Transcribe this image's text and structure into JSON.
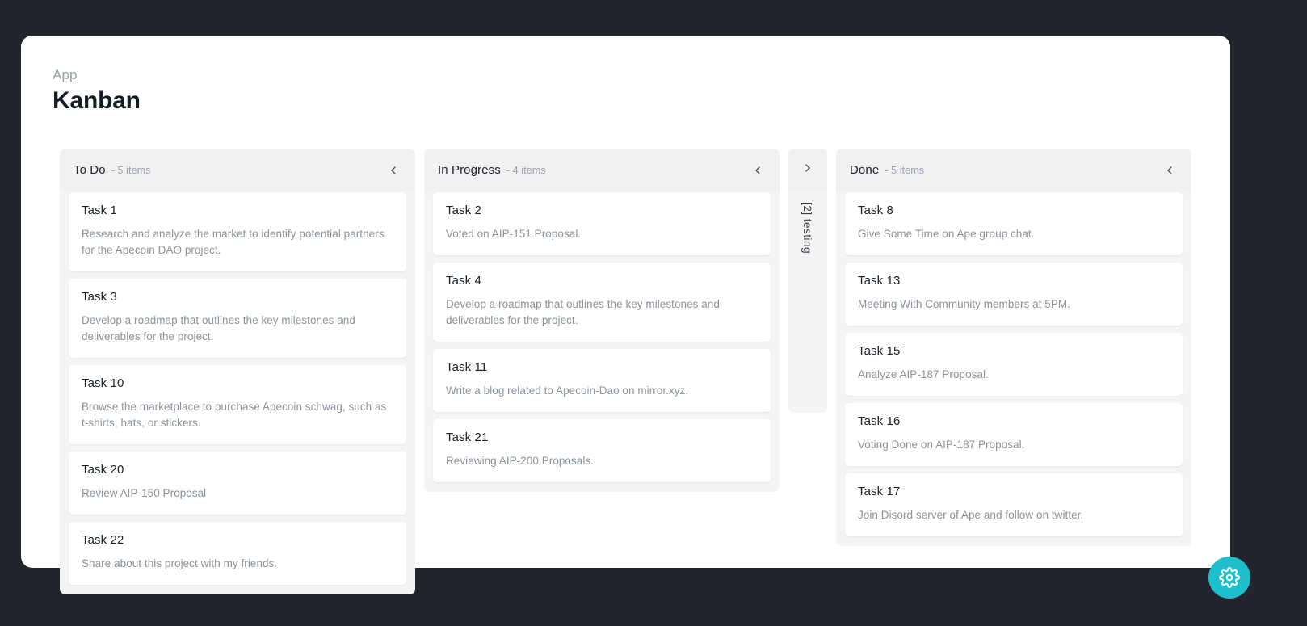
{
  "header": {
    "eyebrow": "App",
    "title": "Kanban"
  },
  "icons": {
    "collapse_left": "chevron-left-icon",
    "expand_right": "chevron-right-icon",
    "settings": "gear-icon"
  },
  "colors": {
    "page_background": "#22252d",
    "card_background": "#ffffff",
    "column_background": "#f4f4f5",
    "column_header_background": "#f1f1f2",
    "accent_fab": "#1fbecd",
    "title_text": "#161b26",
    "muted_text": "#9aa0ab"
  },
  "columns": [
    {
      "id": "todo",
      "title": "To Do",
      "count_label": "- 5 items",
      "collapsed": false,
      "cards": [
        {
          "title": "Task 1",
          "description": "Research and analyze the market to identify potential partners for the Apecoin DAO project."
        },
        {
          "title": "Task 3",
          "description": "Develop a roadmap that outlines the key milestones and deliverables for the project."
        },
        {
          "title": "Task 10",
          "description": "Browse the marketplace to purchase Apecoin schwag, such as t-shirts, hats, or stickers."
        },
        {
          "title": "Task 20",
          "description": "Review AIP-150 Proposal"
        },
        {
          "title": "Task 22",
          "description": "Share about this project with my friends."
        }
      ]
    },
    {
      "id": "in-progress",
      "title": "In Progress",
      "count_label": "- 4 items",
      "collapsed": false,
      "cards": [
        {
          "title": "Task 2",
          "description": "Voted on AIP-151 Proposal."
        },
        {
          "title": "Task 4",
          "description": "Develop a roadmap that outlines the key milestones and deliverables for the project."
        },
        {
          "title": "Task 11",
          "description": "Write a blog related to Apecoin-Dao on mirror.xyz."
        },
        {
          "title": "Task 21",
          "description": "Reviewing AIP-200 Proposals."
        }
      ]
    },
    {
      "id": "testing",
      "title": "[2] testing",
      "count_label": "",
      "collapsed": true,
      "cards": []
    },
    {
      "id": "done",
      "title": "Done",
      "count_label": "- 5 items",
      "collapsed": false,
      "cards": [
        {
          "title": "Task 8",
          "description": "Give Some Time on Ape group chat."
        },
        {
          "title": "Task 13",
          "description": "Meeting With Community members at 5PM."
        },
        {
          "title": "Task 15",
          "description": "Analyze AIP-187 Proposal."
        },
        {
          "title": "Task 16",
          "description": "Voting Done on AIP-187 Proposal."
        },
        {
          "title": "Task 17",
          "description": "Join Disord server of Ape and follow on twitter."
        }
      ]
    }
  ]
}
